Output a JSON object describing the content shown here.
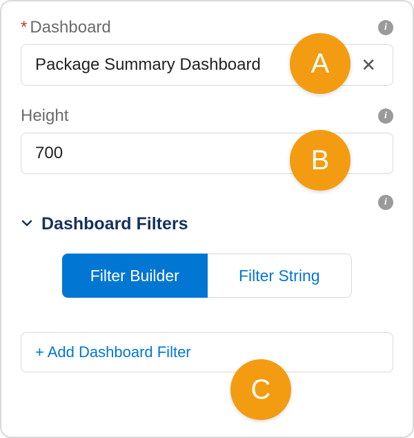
{
  "dashboard": {
    "label": "Dashboard",
    "required_marker": "*",
    "value": "Package Summary Dashboard"
  },
  "height": {
    "label": "Height",
    "value": "700"
  },
  "filters": {
    "section_title": "Dashboard Filters",
    "toggle": {
      "builder": "Filter Builder",
      "string": "Filter String"
    },
    "add_button": "+ Add Dashboard Filter"
  },
  "callouts": {
    "a": "A",
    "b": "B",
    "c": "C"
  }
}
